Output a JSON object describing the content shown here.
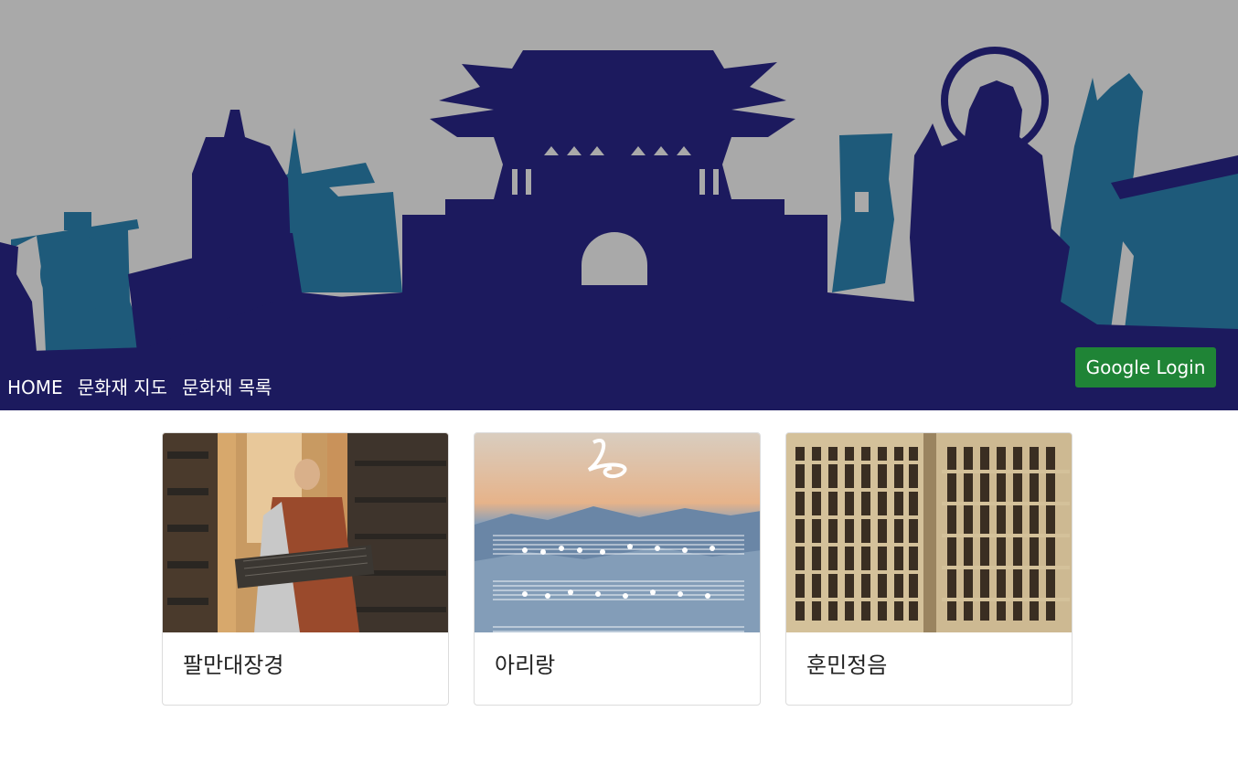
{
  "nav": {
    "home": "HOME",
    "map": "문화재 지도",
    "list": "문화재 목록"
  },
  "login": {
    "label": "Google Login"
  },
  "cards": [
    {
      "title": "팔만대장경"
    },
    {
      "title": "아리랑"
    },
    {
      "title": "훈민정음"
    }
  ],
  "colors": {
    "header_bg": "#a9a9a9",
    "silhouette_dark": "#1c1a5e",
    "silhouette_teal": "#1e5a7a",
    "login_bg": "#1f8436"
  }
}
